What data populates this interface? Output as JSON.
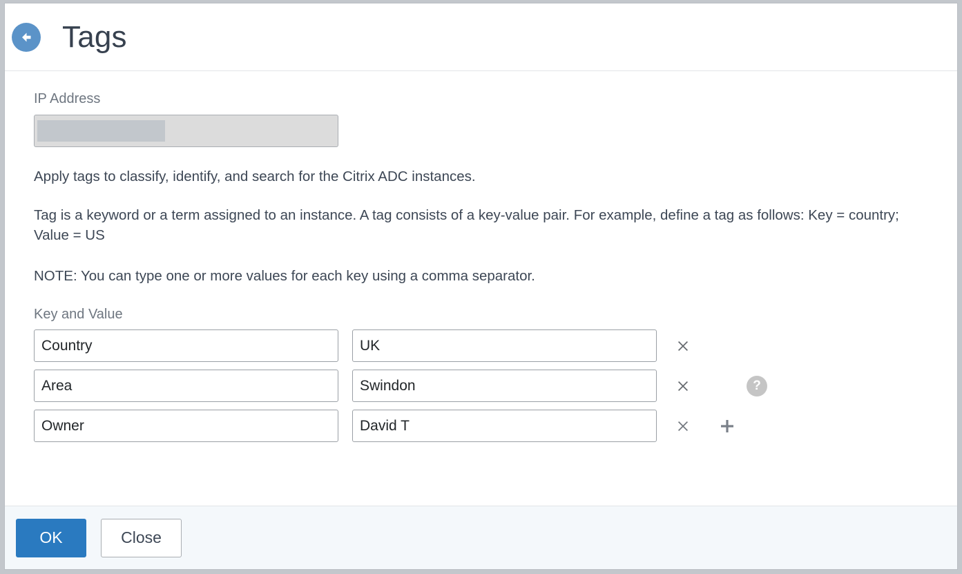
{
  "window": {
    "title": "Tags",
    "back_icon": "back-arrow-icon",
    "accent_blue": "#2a7ac0",
    "back_icon_color": "#5b93c8"
  },
  "form": {
    "ip_address": {
      "label": "IP Address",
      "value": "",
      "redacted": true,
      "disabled": true
    },
    "descriptions": [
      "Apply tags to classify, identify, and search for the Citrix ADC instances.",
      "Tag is a keyword or a term assigned to an instance. A tag consists of a key-value pair. For example, define a tag as follows: Key = country; Value = US",
      "NOTE: You can type one or more values for each key using a comma separator."
    ],
    "key_value": {
      "label": "Key and Value",
      "rows": [
        {
          "key": "Country",
          "value": "UK",
          "remove_icon": "close-icon",
          "has_help": false,
          "has_add": false
        },
        {
          "key": "Area",
          "value": "Swindon",
          "remove_icon": "close-icon",
          "has_help": true,
          "help_icon": "help-circle-icon",
          "has_add": false
        },
        {
          "key": "Owner",
          "value": "David T",
          "remove_icon": "close-icon",
          "has_help": false,
          "has_add": true,
          "add_icon": "plus-icon"
        }
      ]
    }
  },
  "footer": {
    "ok_label": "OK",
    "close_label": "Close"
  }
}
